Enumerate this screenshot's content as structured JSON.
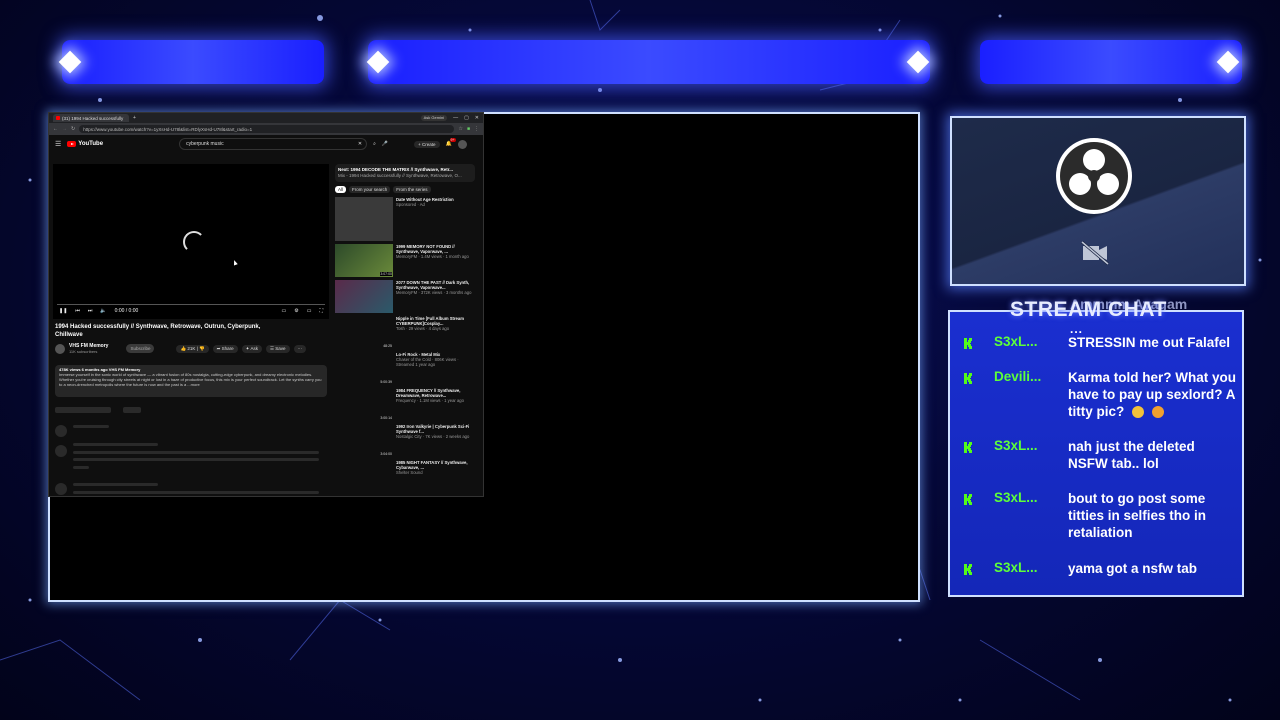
{
  "browser": {
    "tab_title": "(31) 1994 Hacked successfully",
    "window_controls": [
      "—",
      "▢",
      "✕"
    ],
    "url": "https://www.youtube.com/watch?v=1yXsHd-U78l&list=RDlyXsHd-U78l&start_radio=1",
    "ask_gemini": "Ask Gemini"
  },
  "youtube": {
    "logo_text": "YouTube",
    "search_value": "cyberpunk music",
    "create_label": "Create",
    "notif_count": "9+",
    "time": "0:00 / 0:00",
    "video_title": "1994 Hacked successfully // Synthwave, Retrowave, Outrun, Cyberpunk, Chillwave",
    "channel": "VHS FM Memory",
    "subscribers": "11K subscribers",
    "subscribe_label": "Subscribe",
    "like_count": "21K",
    "share_label": "Share",
    "ask_label": "Ask",
    "save_label": "Save",
    "desc_meta": "478K views  6 months ago  VHS FM Memory",
    "desc_text": "Immerse yourself in the sonic world of synthwave — a vibrant fusion of 80s nostalgia, cutting-edge cyberpunk, and dreamy electronic melodies. Whether you're cruising through city streets at night or lost in a haze of productive focus, this mix is your perfect soundtrack. Let the synths carry you to a neon-drenched metropolis where the future is now and the past is a ...more",
    "next_label": "Next: 1994 DECODE THE MATRIX // Synthwave, Retr...",
    "mix_label": "Mix - 1994 Hacked successfully // Synthwave, Retrowave, O...",
    "chips": [
      "All",
      "From your search",
      "From the series"
    ],
    "recs": [
      {
        "title": "Date Without Age Restriction",
        "sub": "Sponsored · Ad"
      },
      {
        "title": "1999 MEMORY NOT FOUND // Synthwave, Vaporwave, ...",
        "sub": "MemoryFM · 1.4M views · 1 month ago"
      },
      {
        "title": "2077 DOWN THE PAST // Dark Synth, Synthwave, Vaporwave...",
        "sub": "MemoryFM · 372K views · 3 months ago"
      },
      {
        "title": "Nipple in Time [Full Album Stream CYBERPUNK]Cosplay...",
        "sub": "Tosh · 29 views · 4 days ago"
      },
      {
        "title": "Lo-Fi Rock - Metal Mix",
        "sub": "Chaser of the Cold · 806K views · Streamed 1 year ago"
      },
      {
        "title": "1984 FREQUENCY // Synthwave, Dreamwave, Retrowave...",
        "sub": "Frequency · 1.1M views · 1 year ago"
      },
      {
        "title": "1992 Iron Valkyrie | Cyberpunk Sci-Fi Synthwave f...",
        "sub": "Nostalgic City · 7K views · 2 weeks ago"
      },
      {
        "title": "1985 NIGHT FANTASY // Synthwave, Cybarwave, ...",
        "sub": "Shelter Sound"
      }
    ],
    "durations": [
      "3:07:00",
      "3:00:47",
      "48:25",
      "5:00:39",
      "3:00:14",
      "3:04:00"
    ]
  },
  "stream": {
    "chat_title": "STREAM CHAT",
    "chat_ghost": "Ammmm Ayagam",
    "chat_dots": "...",
    "messages": [
      {
        "user": "S3xL...",
        "color": "#5dff3a",
        "text": "STRESSIN me out Falafel"
      },
      {
        "user": "Devili...",
        "color": "#5dff3a",
        "text": "Karma told her? What you have to pay up sexlord? A titty pic?"
      },
      {
        "user": "S3xL...",
        "color": "#5dff3a",
        "text": "nah just the deleted NSFW tab.. lol"
      },
      {
        "user": "S3xL...",
        "color": "#5dff3a",
        "text": "bout to go post some titties in selfies tho in retaliation"
      },
      {
        "user": "S3xL...",
        "color": "#5dff3a",
        "text": "yama got a nsfw tab"
      }
    ]
  },
  "colors": {
    "accent": "#1a2fd0",
    "kick_green": "#53fc18"
  }
}
